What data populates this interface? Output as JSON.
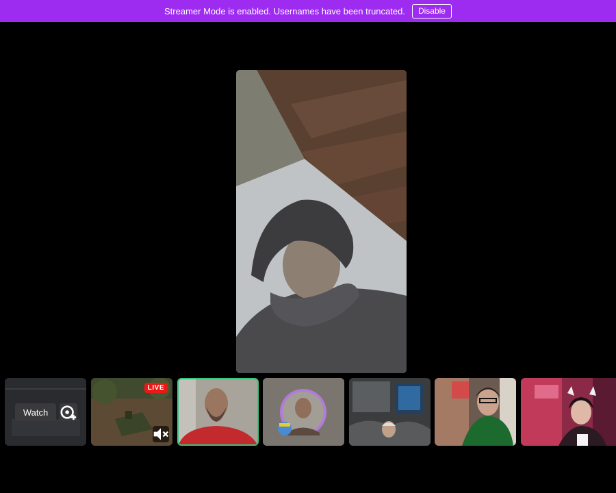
{
  "banner": {
    "message": "Streamer Mode is enabled. Usernames have been truncated.",
    "disable_label": "Disable",
    "color": "#9d2bf0"
  },
  "main_video": {
    "icon": "video-feed"
  },
  "thumbnails": [
    {
      "watch_label": "Watch",
      "icon": "add-squad-icon"
    },
    {
      "badge": "LIVE",
      "icon": "mute-icon"
    },
    {
      "selected": true,
      "accent": "#36c87a"
    },
    {
      "icon": "avatar-badge"
    },
    {},
    {},
    {}
  ]
}
